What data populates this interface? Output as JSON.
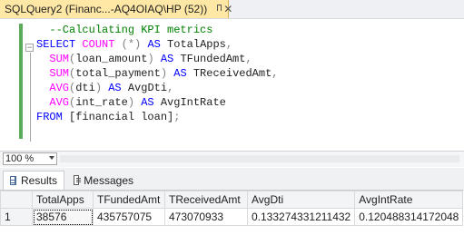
{
  "document_tab": {
    "title": "SQLQuery2 (Financ...-AQ4OIAQ\\HP (52))",
    "pin_icon": "pin-icon",
    "close_icon": "close-icon"
  },
  "editor": {
    "lines": [
      {
        "indent": "  ",
        "parts": [
          {
            "t": "--Calculating KPI metrics",
            "c": "cm"
          }
        ]
      },
      {
        "indent": "",
        "parts": [
          {
            "t": "SELECT",
            "c": "kw"
          },
          {
            "t": " ",
            "c": ""
          },
          {
            "t": "COUNT",
            "c": "fn"
          },
          {
            "t": " ",
            "c": ""
          },
          {
            "t": "(*)",
            "c": "gr"
          },
          {
            "t": " ",
            "c": ""
          },
          {
            "t": "AS",
            "c": "kw"
          },
          {
            "t": " TotalApps",
            "c": ""
          },
          {
            "t": ",",
            "c": "gr"
          }
        ]
      },
      {
        "indent": "  ",
        "parts": [
          {
            "t": "SUM",
            "c": "fn"
          },
          {
            "t": "(",
            "c": "gr"
          },
          {
            "t": "loan_amount",
            "c": ""
          },
          {
            "t": ")",
            "c": "gr"
          },
          {
            "t": " ",
            "c": ""
          },
          {
            "t": "AS",
            "c": "kw"
          },
          {
            "t": " TFundedAmt",
            "c": ""
          },
          {
            "t": ",",
            "c": "gr"
          }
        ]
      },
      {
        "indent": "  ",
        "parts": [
          {
            "t": "SUM",
            "c": "fn"
          },
          {
            "t": "(",
            "c": "gr"
          },
          {
            "t": "total_payment",
            "c": ""
          },
          {
            "t": ")",
            "c": "gr"
          },
          {
            "t": " ",
            "c": ""
          },
          {
            "t": "AS",
            "c": "kw"
          },
          {
            "t": " TReceivedAmt",
            "c": ""
          },
          {
            "t": ",",
            "c": "gr"
          }
        ]
      },
      {
        "indent": "  ",
        "parts": [
          {
            "t": "AVG",
            "c": "fn"
          },
          {
            "t": "(",
            "c": "gr"
          },
          {
            "t": "dti",
            "c": ""
          },
          {
            "t": ")",
            "c": "gr"
          },
          {
            "t": " ",
            "c": ""
          },
          {
            "t": "AS",
            "c": "kw"
          },
          {
            "t": " AvgDti",
            "c": ""
          },
          {
            "t": ",",
            "c": "gr"
          }
        ]
      },
      {
        "indent": "  ",
        "parts": [
          {
            "t": "AVG",
            "c": "fn"
          },
          {
            "t": "(",
            "c": "gr"
          },
          {
            "t": "int_rate",
            "c": ""
          },
          {
            "t": ")",
            "c": "gr"
          },
          {
            "t": " ",
            "c": ""
          },
          {
            "t": "AS",
            "c": "kw"
          },
          {
            "t": " AvgIntRate",
            "c": ""
          }
        ]
      },
      {
        "indent": "",
        "parts": [
          {
            "t": "FROM",
            "c": "kw"
          },
          {
            "t": " [financial loan]",
            "c": ""
          },
          {
            "t": ";",
            "c": "gr"
          }
        ]
      }
    ]
  },
  "zoom": {
    "value": "100 %"
  },
  "results_tabs": [
    {
      "label": "Results",
      "icon": "grid-icon",
      "active": true
    },
    {
      "label": "Messages",
      "icon": "messages-icon",
      "active": false
    }
  ],
  "results": {
    "columns": [
      "TotalApps",
      "TFundedAmt",
      "TReceivedAmt",
      "AvgDti",
      "AvgIntRate"
    ],
    "rows": [
      {
        "num": "1",
        "cells": [
          "38576",
          "435757075",
          "473070933",
          "0.133274331211432",
          "0.120488314172048"
        ]
      }
    ]
  },
  "colors": {
    "tab_active": "#ffe8a6",
    "keyword": "#0000ff",
    "function": "#ff00ff",
    "comment": "#008000",
    "change_bar": "#5bab5b"
  }
}
